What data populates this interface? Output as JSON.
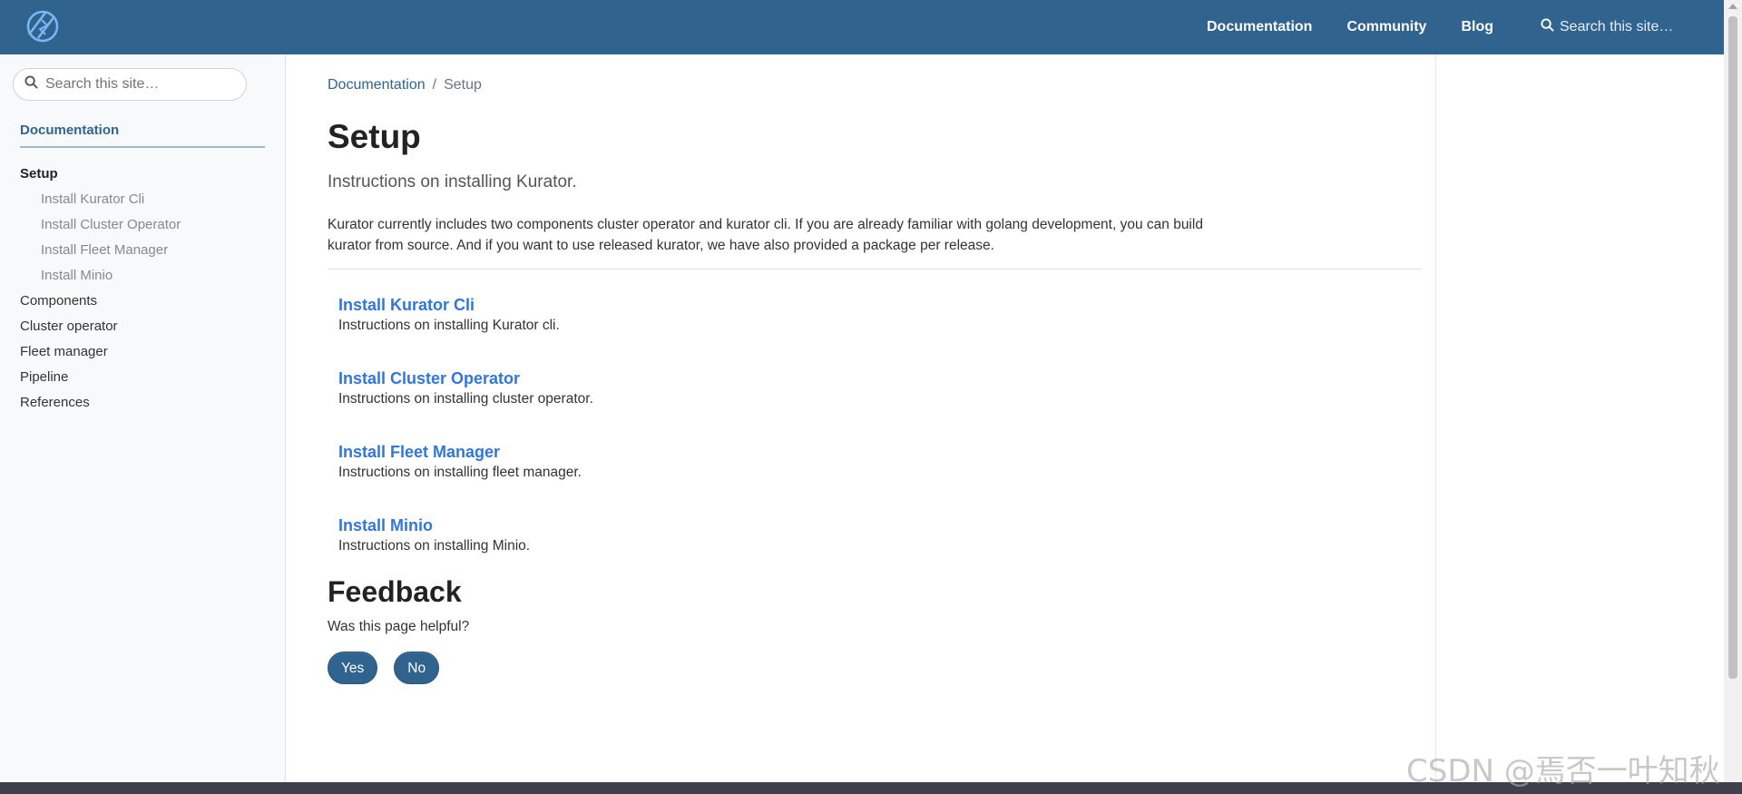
{
  "navbar": {
    "links": [
      "Documentation",
      "Community",
      "Blog"
    ],
    "search_placeholder": "Search this site…"
  },
  "sidebar": {
    "search_placeholder": "Search this site…",
    "section": "Documentation",
    "items": [
      {
        "label": "Setup",
        "level": 0,
        "active": true
      },
      {
        "label": "Install Kurator Cli",
        "level": 1
      },
      {
        "label": "Install Cluster Operator",
        "level": 1
      },
      {
        "label": "Install Fleet Manager",
        "level": 1
      },
      {
        "label": "Install Minio",
        "level": 1
      },
      {
        "label": "Components",
        "level": 0
      },
      {
        "label": "Cluster operator",
        "level": 0
      },
      {
        "label": "Fleet manager",
        "level": 0
      },
      {
        "label": "Pipeline",
        "level": 0
      },
      {
        "label": "References",
        "level": 0
      }
    ]
  },
  "main": {
    "breadcrumb": {
      "parent": "Documentation",
      "separator": "/",
      "current": "Setup"
    },
    "title": "Setup",
    "lead": "Instructions on installing Kurator.",
    "body": "Kurator currently includes two components cluster operator and kurator cli. If you are already familiar with golang development, you can build kurator from source. And if you want to use released kurator, we have also provided a package per release.",
    "entries": [
      {
        "title": "Install Kurator Cli",
        "desc": "Instructions on installing Kurator cli."
      },
      {
        "title": "Install Cluster Operator",
        "desc": "Instructions on installing cluster operator."
      },
      {
        "title": "Install Fleet Manager",
        "desc": "Instructions on installing fleet manager."
      },
      {
        "title": "Install Minio",
        "desc": "Instructions on installing Minio."
      }
    ],
    "feedback": {
      "title": "Feedback",
      "question": "Was this page helpful?",
      "yes": "Yes",
      "no": "No"
    }
  },
  "watermark": "CSDN @焉否一叶知秋",
  "colors": {
    "brand": "#30638e",
    "link": "#3176d9",
    "footer": "#403f4c"
  }
}
